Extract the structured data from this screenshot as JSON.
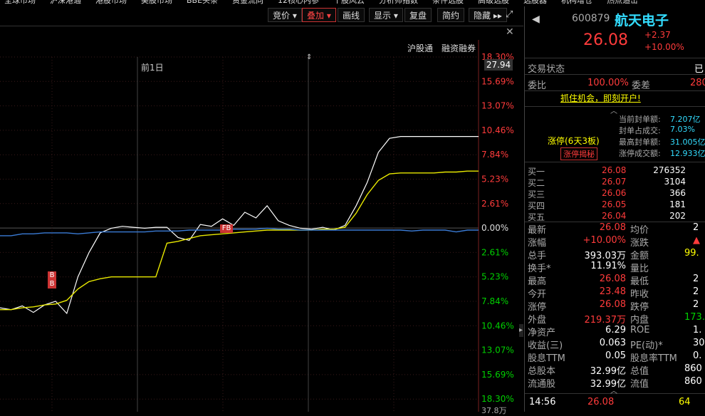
{
  "top_menu": [
    "全球市场",
    "沪深港通",
    "港股市场",
    "美股市场",
    "BBE头条",
    "资金流向",
    "12核心内参",
    "个股风云",
    "分析师指数",
    "条件选股",
    "高级选股",
    "选股器",
    "机构增仓",
    "热点追击"
  ],
  "toolbar": {
    "buttons": [
      {
        "label": "竞价 ▾",
        "active": false
      },
      {
        "label": "叠加 ▾",
        "active": true
      },
      {
        "label": "画线",
        "active": false
      },
      {
        "label": "显示 ▾",
        "active": false
      },
      {
        "label": "复盘",
        "active": false
      },
      {
        "label": "简约",
        "active": false
      },
      {
        "label": "隐藏 ▸▸",
        "active": false
      }
    ]
  },
  "subbar": {
    "hk_connect": "沪股通",
    "margin": "融资融券"
  },
  "chart": {
    "day_label": "前1日",
    "price_box": "27.94",
    "right_axis": [
      "18.30%",
      "15.69%",
      "13.07%",
      "10.46%",
      "7.84%",
      "5.23%",
      "2.61%",
      "0.00%",
      "2.61%",
      "5.23%",
      "7.84%",
      "10.46%",
      "13.07%",
      "15.69%",
      "18.30%"
    ],
    "bottom_label": "37.8万",
    "markers": {
      "b1": "B",
      "b2": "B",
      "fb": "FB"
    }
  },
  "chart_data": {
    "type": "line",
    "series": [
      {
        "values": [
          -8.3,
          -8.5,
          -8.1,
          -8.8,
          -8.0,
          -7.6,
          -8.9,
          -5.0,
          -2.4,
          -0.3,
          0.2,
          0.4,
          0.3,
          0.2,
          0.3,
          0.3,
          -0.8,
          -1.1,
          0.6,
          0.4,
          1.2,
          0.5,
          1.9,
          1.3,
          2.6,
          1.0,
          0.5,
          0.2,
          0.1,
          0.3,
          0.0,
          0.5,
          2.6,
          5.1,
          8.3,
          9.8,
          10.0,
          10.0,
          10.0,
          10.0,
          10.0,
          10.0,
          10.0,
          10.0
        ]
      },
      {
        "values": [
          -8.5,
          -8.5,
          -8.3,
          -8.2,
          -8.0,
          -7.9,
          -7.5,
          -6.3,
          -5.5,
          -5.2,
          -5.0,
          -5.0,
          -5.0,
          -5.0,
          -5.0,
          -1.4,
          -1.2,
          -0.9,
          -0.6,
          -0.5,
          -0.4,
          -0.3,
          -0.2,
          -0.1,
          0.0,
          0.0,
          0.0,
          0.0,
          0.0,
          0.1,
          0.1,
          0.3,
          1.8,
          3.8,
          5.3,
          6.0,
          6.1,
          6.1,
          6.1,
          6.1,
          6.2,
          6.2,
          6.3,
          6.3
        ]
      },
      {
        "values": [
          -0.6,
          -0.6,
          -0.4,
          -0.4,
          -0.3,
          -0.3,
          -0.3,
          -0.4,
          -0.3,
          -0.2,
          -0.2,
          -0.2,
          -0.2,
          -0.2,
          -0.1,
          -0.1,
          -0.1,
          0.0,
          0.0,
          0.0,
          0.0,
          0.1,
          0.1,
          0.1,
          0.2,
          0.1,
          0.1,
          0.0,
          0.0,
          0.0,
          0.0,
          0.0,
          0.0,
          0.0,
          0.0,
          0.0,
          0.0,
          -0.1,
          0.0,
          0.0,
          0.0,
          -0.2,
          0.0,
          0.0
        ]
      }
    ],
    "colors": {
      "price": "#ffffff",
      "avg": "#e8e800",
      "index": "#3a7bd5",
      "up": "#ff3b3b",
      "down": "#00d000"
    }
  },
  "panel": {
    "code": "600879",
    "name": "航天电子",
    "price": "26.08",
    "change": "+2.37",
    "change_pct": "+10.00%",
    "trade_status_label": "交易状态",
    "trade_status_value": "已",
    "ratio_label": "委比",
    "ratio_value": "100.00%",
    "diff_label": "委差",
    "diff_value": "280",
    "promo": "抓住机会，即刻开户!",
    "limit_info": [
      {
        "label": "当前封单额:",
        "value": "7.207亿"
      },
      {
        "label": "封单占成交:",
        "value": "7.03%"
      },
      {
        "label": "最高封单额:",
        "value": "31.005亿"
      },
      {
        "label": "涨停成交额:",
        "value": "12.933亿"
      }
    ],
    "limit_tag": "涨停(6天3板)",
    "limit_button": "涨停揭秘",
    "bids": [
      {
        "label": "买一",
        "price": "26.08",
        "vol": "276352"
      },
      {
        "label": "买二",
        "price": "26.07",
        "vol": "3104"
      },
      {
        "label": "买三",
        "price": "26.06",
        "vol": "366"
      },
      {
        "label": "买四",
        "price": "26.05",
        "vol": "181"
      },
      {
        "label": "买五",
        "price": "26.04",
        "vol": "202"
      }
    ],
    "stats": [
      {
        "l1": "最新",
        "v1": "26.08",
        "l2": "均价",
        "v2": "2"
      },
      {
        "l1": "涨幅",
        "v1": "+10.00%",
        "l2": "涨跌",
        "v2": "▲"
      },
      {
        "l1": "总手",
        "v1": "393.03万",
        "l2": "金额",
        "v2": "99."
      },
      {
        "l1": "换手*",
        "v1": "11.91%",
        "l2": "量比",
        "v2": ""
      },
      {
        "l1": "最高",
        "v1": "26.08",
        "l2": "最低",
        "v2": "2"
      },
      {
        "l1": "今开",
        "v1": "23.48",
        "l2": "昨收",
        "v2": "2"
      },
      {
        "l1": "涨停",
        "v1": "26.08",
        "l2": "跌停",
        "v2": "2"
      },
      {
        "l1": "外盘",
        "v1": "219.37万",
        "l2": "内盘",
        "v2": "173."
      },
      {
        "l1": "净资产",
        "v1": "6.29",
        "l2": "ROE",
        "v2": "1."
      },
      {
        "l1": "收益(三)",
        "v1": "0.063",
        "l2": "PE(动)*",
        "v2": "30"
      },
      {
        "l1": "股息TTM",
        "v1": "0.05",
        "l2": "股息率TTM",
        "v2": "0."
      },
      {
        "l1": "总股本",
        "v1": "32.99亿",
        "l2": "总值",
        "v2": "860"
      },
      {
        "l1": "流通股",
        "v1": "32.99亿",
        "l2": "流值",
        "v2": "860"
      }
    ],
    "tick": {
      "time": "14:56",
      "price": "26.08",
      "vol": "64"
    }
  }
}
